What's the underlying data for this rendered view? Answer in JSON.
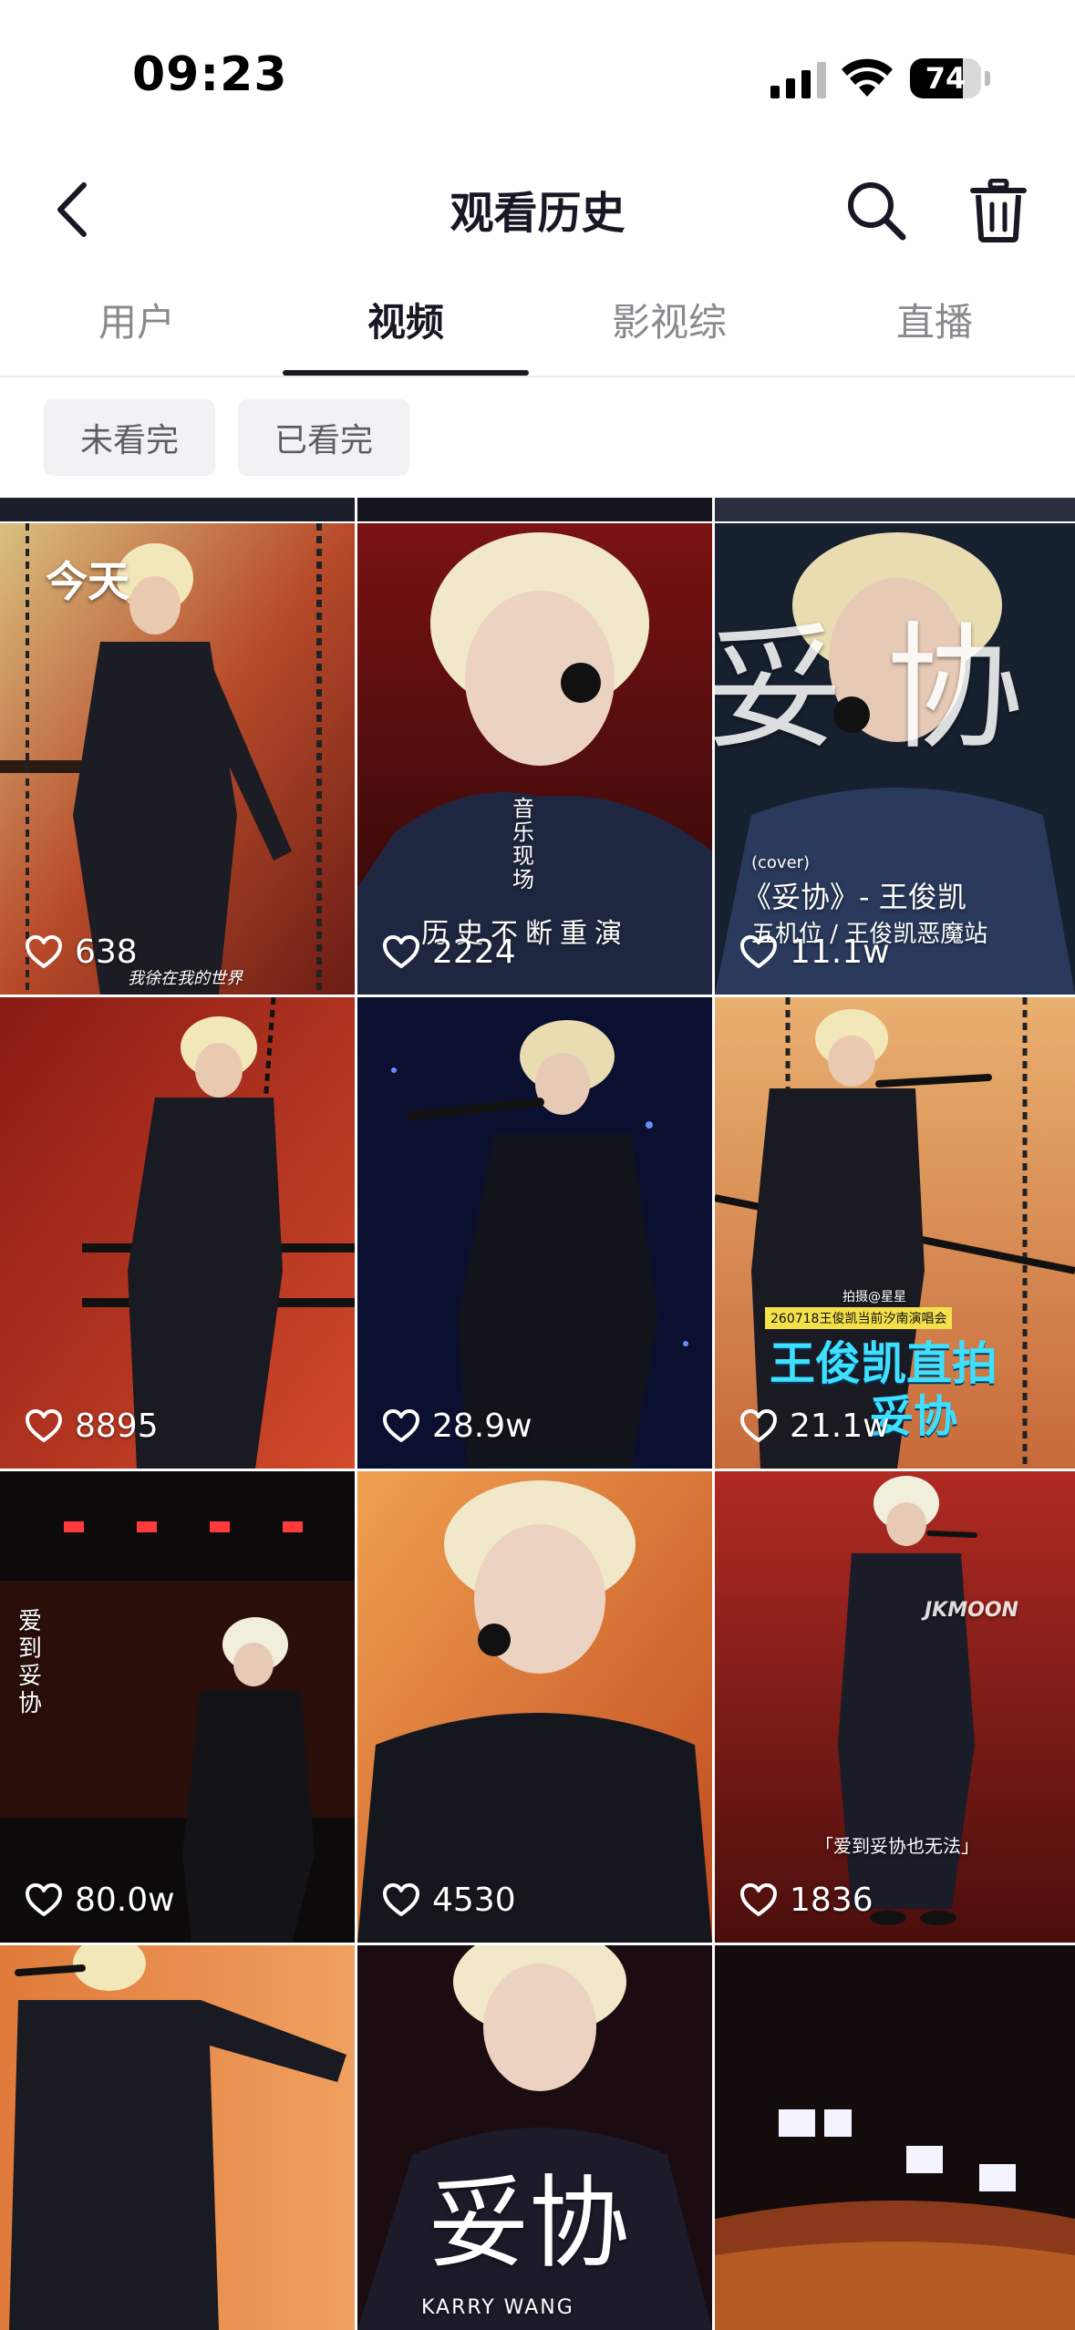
{
  "status_bar": {
    "time": "09:23",
    "battery_level": 74,
    "battery_text": "74"
  },
  "header": {
    "title": "观看历史",
    "back_icon": "chevron-left-icon",
    "search_icon": "search-icon",
    "trash_icon": "trash-icon"
  },
  "tabs": [
    {
      "label": "用户",
      "active": false
    },
    {
      "label": "视频",
      "active": true
    },
    {
      "label": "影视综",
      "active": false
    },
    {
      "label": "直播",
      "active": false
    }
  ],
  "filters": [
    {
      "label": "未看完"
    },
    {
      "label": "已看完"
    }
  ],
  "grid": {
    "section_label": "今天",
    "videos": [
      {
        "likes": "638",
        "caption": "我徐在我的世界"
      },
      {
        "likes": "2224",
        "caption": "历史不断重演",
        "stamp": "音乐现场"
      },
      {
        "likes": "11.1w",
        "caption_top": "(cover)",
        "caption": "《妥协》- 王俊凯",
        "caption2": "五机位 / 王俊凯恶魔站",
        "big_glyph": "妥 协"
      },
      {
        "likes": "8895"
      },
      {
        "likes": "28.9w"
      },
      {
        "likes": "21.1w",
        "badge": "260718王俊凯当前汐南演唱会",
        "caption": "王俊凯直拍",
        "caption2": "妥协",
        "small_text": "拍摄@星星"
      },
      {
        "likes": "80.0w",
        "side_text": "爱到妥协"
      },
      {
        "likes": "4530"
      },
      {
        "likes": "1836",
        "watermark": "JKMOON",
        "caption": "「爱到妥协也无法」"
      },
      {
        "likes": ""
      },
      {
        "likes": "",
        "caption": "妥协",
        "caption2": "KARRY WANG"
      },
      {
        "likes": ""
      }
    ]
  },
  "colors": {
    "accent": "#161823",
    "chip_bg": "#f2f2f4",
    "muted": "#8a8a8e"
  }
}
